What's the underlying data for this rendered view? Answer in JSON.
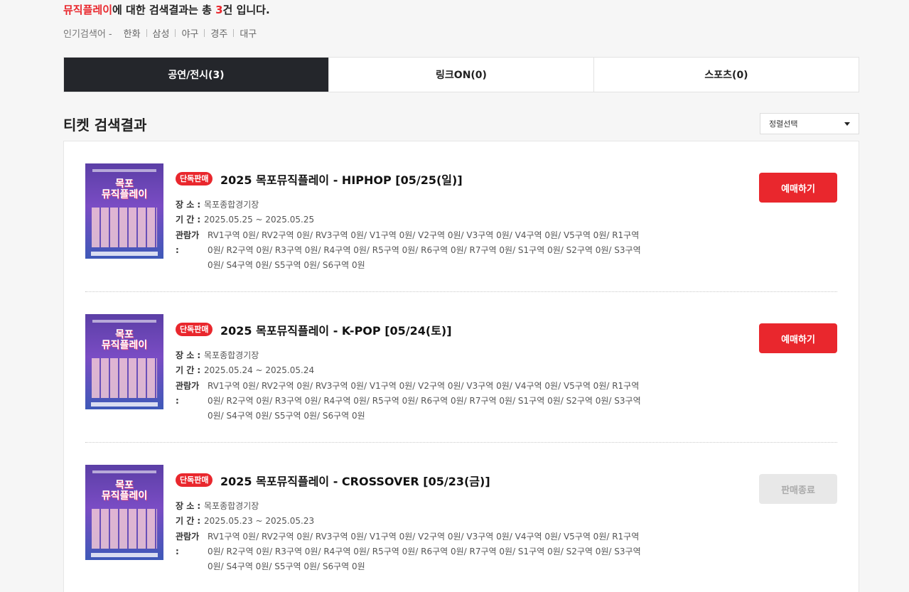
{
  "header": {
    "keyword": "뮤직플레이",
    "mid": "에 대한 검색결과는 총 ",
    "count": "3",
    "tail": "건 입니다."
  },
  "popular": {
    "label": "인기검색어 -",
    "tags": [
      "한화",
      "삼성",
      "야구",
      "경주",
      "대구"
    ]
  },
  "tabs": [
    {
      "label": "공연/전시(3)",
      "active": true
    },
    {
      "label": "링크ON(0)",
      "active": false
    },
    {
      "label": "스포츠(0)",
      "active": false
    }
  ],
  "section": {
    "title": "티켓 검색결과",
    "sort_label": "정렬선택"
  },
  "poster": {
    "title_line1": "목포",
    "title_line2": "뮤직플레이"
  },
  "labels": {
    "badge": "단독판매",
    "place": "장  소 :",
    "period": "기  간 :",
    "price": "관람가 :"
  },
  "items": [
    {
      "title": "2025 목포뮤직플레이 - HIPHOP [05/25(일)]",
      "place": "목포종합경기장",
      "period": "2025.05.25 ~ 2025.05.25",
      "price": "RV1구역 0원/ RV2구역 0원/ RV3구역 0원/ V1구역 0원/ V2구역 0원/ V3구역 0원/ V4구역 0원/ V5구역 0원/ R1구역 0원/ R2구역 0원/ R3구역 0원/ R4구역 0원/ R5구역 0원/ R6구역 0원/ R7구역 0원/ S1구역 0원/ S2구역 0원/ S3구역 0원/ S4구역 0원/ S5구역 0원/ S6구역 0원",
      "button": "예매하기",
      "status": "buy"
    },
    {
      "title": "2025 목포뮤직플레이 - K-POP [05/24(토)]",
      "place": "목포종합경기장",
      "period": "2025.05.24 ~ 2025.05.24",
      "price": "RV1구역 0원/ RV2구역 0원/ RV3구역 0원/ V1구역 0원/ V2구역 0원/ V3구역 0원/ V4구역 0원/ V5구역 0원/ R1구역 0원/ R2구역 0원/ R3구역 0원/ R4구역 0원/ R5구역 0원/ R6구역 0원/ R7구역 0원/ S1구역 0원/ S2구역 0원/ S3구역 0원/ S4구역 0원/ S5구역 0원/ S6구역 0원",
      "button": "예매하기",
      "status": "buy"
    },
    {
      "title": "2025 목포뮤직플레이 - CROSSOVER [05/23(금)]",
      "place": "목포종합경기장",
      "period": "2025.05.23 ~ 2025.05.23",
      "price": "RV1구역 0원/ RV2구역 0원/ RV3구역 0원/ V1구역 0원/ V2구역 0원/ V3구역 0원/ V4구역 0원/ V5구역 0원/ R1구역 0원/ R2구역 0원/ R3구역 0원/ R4구역 0원/ R5구역 0원/ R6구역 0원/ R7구역 0원/ S1구역 0원/ S2구역 0원/ S3구역 0원/ S4구역 0원/ S5구역 0원/ S6구역 0원",
      "button": "판매종료",
      "status": "closed"
    }
  ]
}
